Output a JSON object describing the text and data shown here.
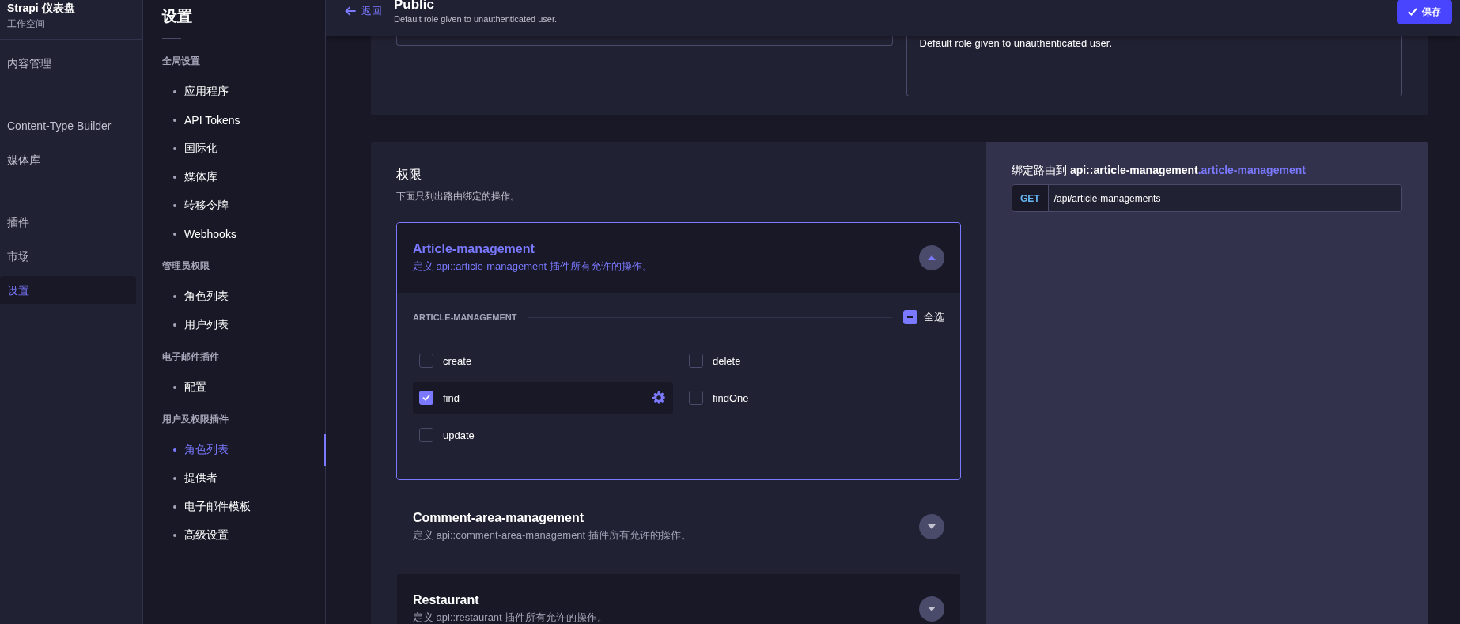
{
  "nav": {
    "brand": "Strapi 仪表盘",
    "workspace": "工作空间",
    "groups": [
      {
        "items": [
          {
            "label": "内容管理",
            "selected": false
          }
        ]
      },
      {
        "items": [
          {
            "label": "Content-Type Builder",
            "selected": false
          },
          {
            "label": "媒体库",
            "selected": false
          }
        ]
      },
      {
        "items": [
          {
            "label": "插件",
            "selected": false
          },
          {
            "label": "市场",
            "selected": false
          },
          {
            "label": "设置",
            "selected": true
          }
        ]
      }
    ]
  },
  "settings": {
    "title": "设置",
    "sections": [
      {
        "heading": "全局设置",
        "items": [
          {
            "label": "应用程序",
            "selected": false
          },
          {
            "label": "API Tokens",
            "selected": false
          },
          {
            "label": "国际化",
            "selected": false
          },
          {
            "label": "媒体库",
            "selected": false
          },
          {
            "label": "转移令牌",
            "selected": false
          },
          {
            "label": "Webhooks",
            "selected": false
          }
        ]
      },
      {
        "heading": "管理员权限",
        "items": [
          {
            "label": "角色列表",
            "selected": false
          },
          {
            "label": "用户列表",
            "selected": false
          }
        ]
      },
      {
        "heading": "电子邮件插件",
        "items": [
          {
            "label": "配置",
            "selected": false
          }
        ]
      },
      {
        "heading": "用户及权限插件",
        "items": [
          {
            "label": "角色列表",
            "selected": true
          },
          {
            "label": "提供者",
            "selected": false
          },
          {
            "label": "电子邮件模板",
            "selected": false
          },
          {
            "label": "高级设置",
            "selected": false
          }
        ]
      }
    ]
  },
  "header": {
    "back": "返回",
    "title": "Public",
    "subtitle": "Default role given to unauthenticated user.",
    "save": "保存"
  },
  "role_form": {
    "description": "Default role given to unauthenticated user."
  },
  "permissions": {
    "title": "权限",
    "subtitle": "下面只列出路由绑定的操作。",
    "groups": [
      {
        "name": "Article-management",
        "description": "定义 api::article-management 插件所有允许的操作。",
        "expanded": true,
        "shaded": true,
        "section_label": "ARTICLE-MANAGEMENT",
        "select_all": {
          "label": "全选",
          "indeterminate": true
        },
        "actions": [
          {
            "label": "create",
            "checked": false,
            "selected": false
          },
          {
            "label": "delete",
            "checked": false,
            "selected": false
          },
          {
            "label": "find",
            "checked": true,
            "selected": true
          },
          {
            "label": "findOne",
            "checked": false,
            "selected": false
          },
          {
            "label": "update",
            "checked": false,
            "selected": false
          }
        ]
      },
      {
        "name": "Comment-area-management",
        "description": "定义 api::comment-area-management 插件所有允许的操作。",
        "expanded": false,
        "shaded": false
      },
      {
        "name": "Restaurant",
        "description": "定义 api::restaurant 插件所有允许的操作。",
        "expanded": false,
        "shaded": true
      }
    ]
  },
  "route": {
    "title": "绑定路由到 **api::article-management**",
    "action": ".article-management",
    "method": "GET",
    "path": "/api/article-managements"
  }
}
